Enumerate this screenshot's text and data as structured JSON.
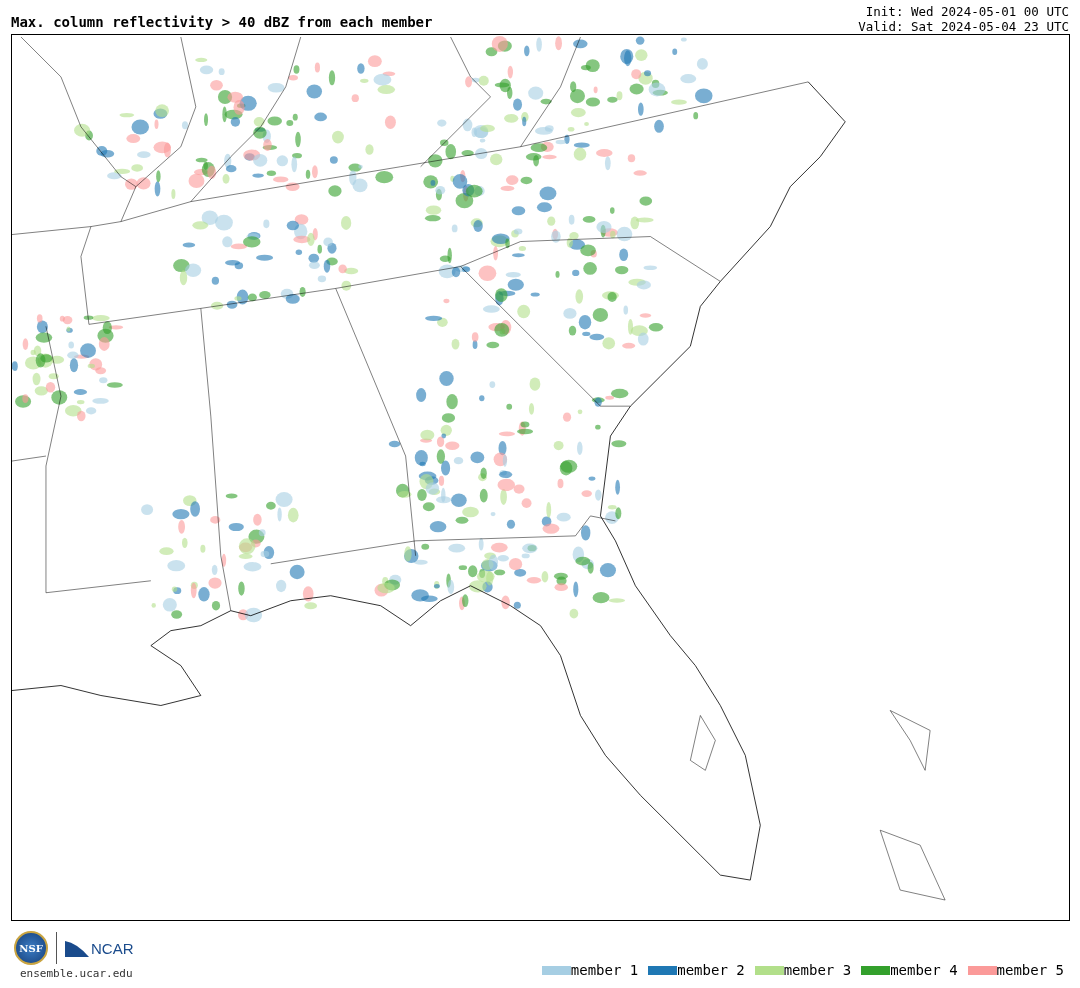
{
  "title": "Max. column reflectivity > 40 dBZ from each member",
  "init": "Init: Wed 2024-05-01 00 UTC",
  "valid": "Valid: Sat 2024-05-04 23 UTC",
  "logos": {
    "nsf": "NSF",
    "ncar": "NCAR",
    "url": "ensemble.ucar.edu"
  },
  "legend": [
    {
      "label": "member 1",
      "color": "#a6cee3"
    },
    {
      "label": "member 2",
      "color": "#1f78b4"
    },
    {
      "label": "member 3",
      "color": "#b2df8a"
    },
    {
      "label": "member 4",
      "color": "#33a02c"
    },
    {
      "label": "member 5",
      "color": "#fb9a99"
    }
  ]
}
